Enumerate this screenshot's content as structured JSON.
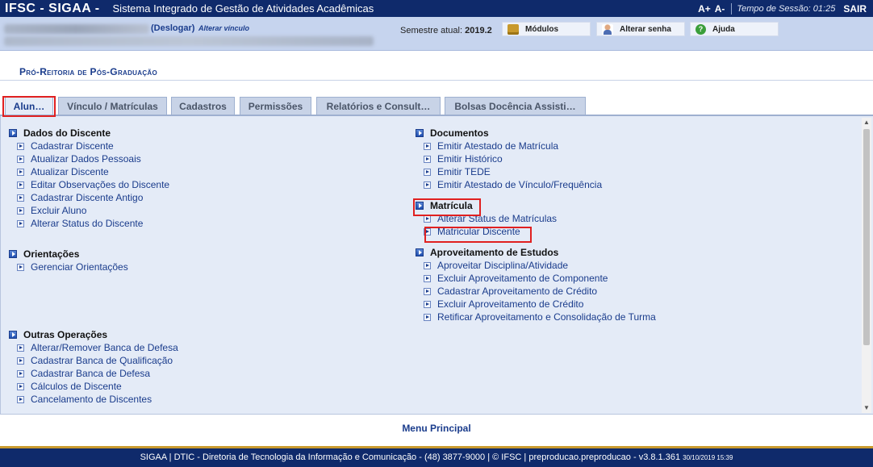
{
  "topbar": {
    "system_name": "IFSC - SIGAA -",
    "system_full": "Sistema Integrado de Gestão de Atividades Acadêmicas",
    "font_increase": "A+",
    "font_decrease": "A-",
    "session_label": "Tempo de Sessão: 01:25",
    "logout": "SAIR"
  },
  "userbar": {
    "deslogar": "(Deslogar)",
    "alterar_vinculo": "Alterar vínculo",
    "semestre_label": "Semestre atual:",
    "semestre_value": "2019.2",
    "buttons": {
      "modulos": "Módulos",
      "alterar_senha": "Alterar senha",
      "ajuda": "Ajuda"
    }
  },
  "page": {
    "title": "Pró-Reitoria de Pós-Graduação"
  },
  "tabs": [
    {
      "label": "Alun…",
      "active": true
    },
    {
      "label": "Vínculo / Matrículas",
      "active": false
    },
    {
      "label": "Cadastros",
      "active": false
    },
    {
      "label": "Permissões",
      "active": false
    },
    {
      "label": "Relatórios e Consult…",
      "active": false
    },
    {
      "label": "Bolsas Docência Assisti…",
      "active": false
    }
  ],
  "left_sections": [
    {
      "title": "Dados do Discente",
      "items": [
        "Cadastrar Discente",
        "Atualizar Dados Pessoais",
        "Atualizar Discente",
        "Editar Observações do Discente",
        "Cadastrar Discente Antigo",
        "Excluir Aluno",
        "Alterar Status do Discente"
      ]
    },
    {
      "title": "Orientações",
      "items": [
        "Gerenciar Orientações"
      ]
    },
    {
      "title": "Outras Operações",
      "items": [
        "Alterar/Remover Banca de Defesa",
        "Cadastrar Banca de Qualificação",
        "Cadastrar Banca de Defesa",
        "Cálculos de Discente",
        "Cancelamento de Discentes"
      ]
    }
  ],
  "right_sections": [
    {
      "title": "Documentos",
      "items": [
        "Emitir Atestado de Matrícula",
        "Emitir Histórico",
        "Emitir TEDE",
        "Emitir Atestado de Vínculo/Frequência"
      ]
    },
    {
      "title": "Matrícula",
      "items": [
        "Alterar Status de Matrículas",
        "Matricular Discente"
      ]
    },
    {
      "title": "Aproveitamento de Estudos",
      "items": [
        "Aproveitar Disciplina/Atividade",
        "Excluir Aproveitamento de Componente",
        "Cadastrar Aproveitamento de Crédito",
        "Excluir Aproveitamento de Crédito",
        "Retificar Aproveitamento e Consolidação de Turma"
      ]
    }
  ],
  "menu_principal": "Menu Principal",
  "footer": {
    "text": "SIGAA | DTIC - Diretoria de Tecnologia da Informação e Comunicação - (48) 3877-9000 | © IFSC | preproducao.preproducao - v3.8.1.361",
    "timestamp": "30/10/2019 15:39"
  },
  "colors": {
    "topbar_bg": "#0f2a6b",
    "userbar_bg": "#c6d4ee",
    "panel_bg": "#e4ebf7",
    "link": "#1a3c8c",
    "highlight": "#e02020",
    "footer_accent": "#c99a2e"
  }
}
